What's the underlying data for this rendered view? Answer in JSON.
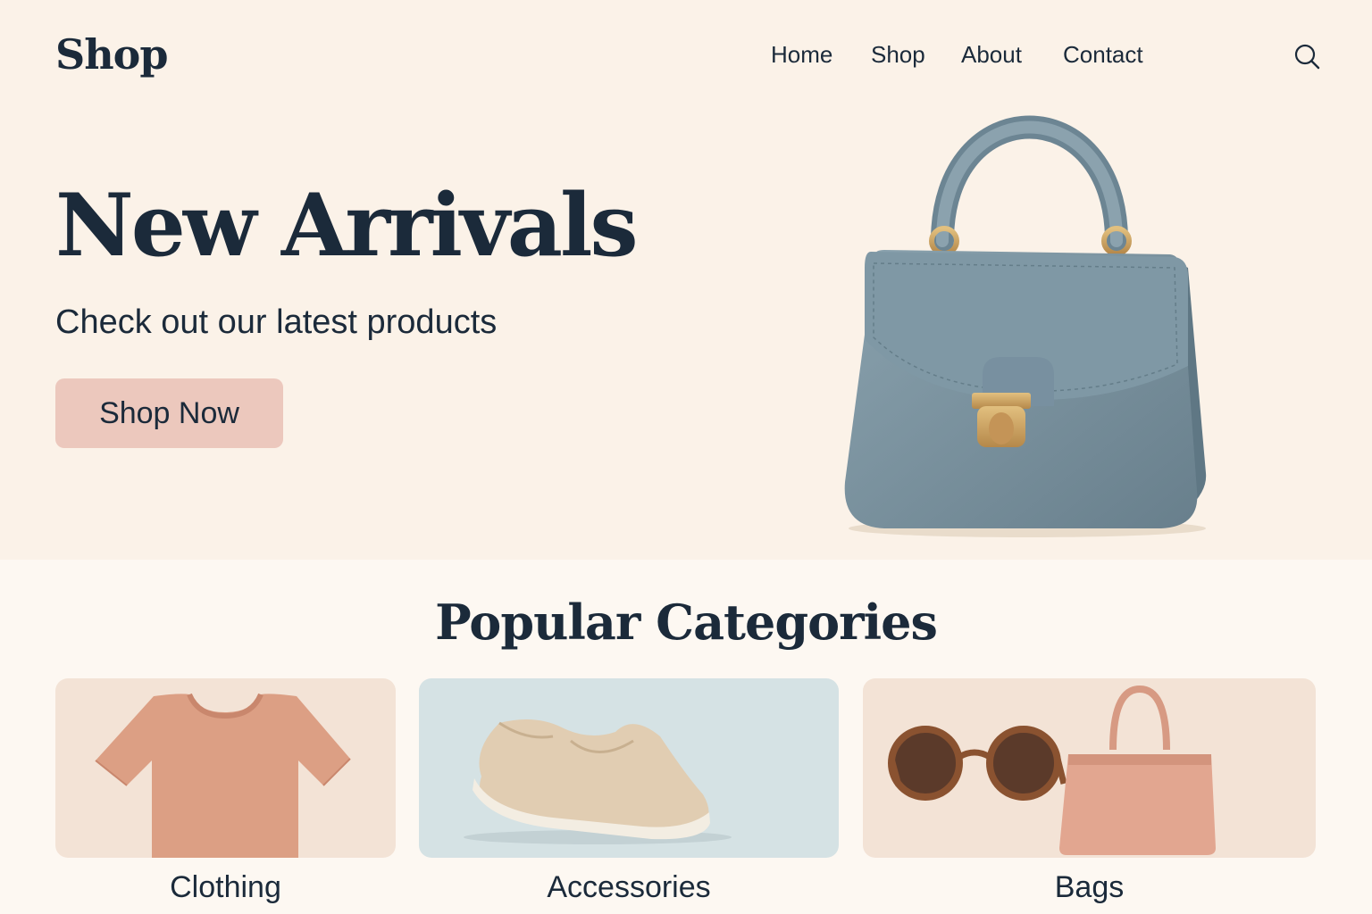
{
  "header": {
    "logo": "Shop",
    "nav": [
      "Home",
      "Shop",
      "About",
      "Contact"
    ],
    "search_icon": "search-icon"
  },
  "hero": {
    "title": "New Arrivals",
    "subtitle": "Check out our latest products",
    "cta_label": "Shop Now",
    "image": "handbag-image"
  },
  "categories": {
    "title": "Popular Categories",
    "items": [
      {
        "label": "Clothing",
        "image": "tshirt-image"
      },
      {
        "label": "Accessories",
        "image": "shoe-image"
      },
      {
        "label": "Bags",
        "image": "sunglasses-tote-image"
      }
    ]
  },
  "colors": {
    "hero_bg": "#fbf2e8",
    "text": "#1b2a3a",
    "button": "#ecc8bd",
    "bag": "#7a93a0",
    "gold": "#c9a062"
  }
}
